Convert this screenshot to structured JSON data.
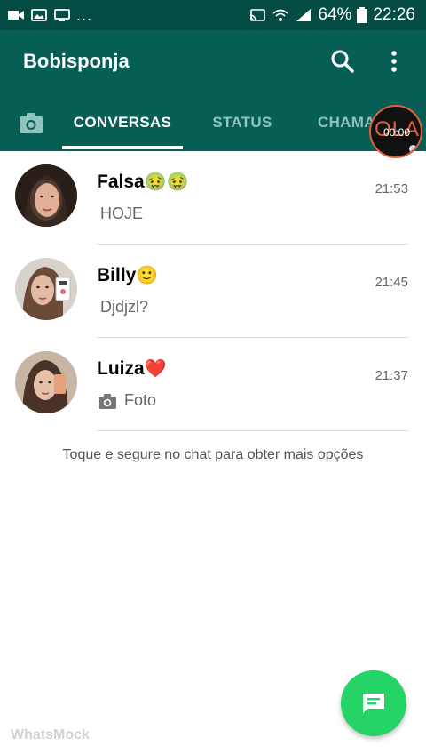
{
  "status_bar": {
    "dots": "...",
    "battery": "64%",
    "time": "22:26"
  },
  "app_bar": {
    "title": "Bobisponja",
    "tabs": [
      {
        "label": "CONVERSAS",
        "active": true
      },
      {
        "label": "STATUS",
        "active": false
      },
      {
        "label": "CHAMADAS",
        "active": false
      }
    ],
    "record_overlay": {
      "letters": "OLA",
      "time": "00:00"
    }
  },
  "chats": [
    {
      "name": "Falsa",
      "name_emoji": "🤢🤢",
      "time": "21:53",
      "message": "HOJE",
      "message_icon": ""
    },
    {
      "name": "Billy",
      "name_emoji": "🙂",
      "time": "21:45",
      "message": "Djdjzl?",
      "message_icon": ""
    },
    {
      "name": "Luiza",
      "name_emoji": "❤️",
      "time": "21:37",
      "message": "Foto",
      "message_icon": "camera-icon"
    }
  ],
  "hint": "Toque e segure no chat para obter mais opções",
  "watermark": "WhatsMock",
  "colors": {
    "status_bar": "#054d44",
    "app_bar": "#075e54",
    "inactive_tab": "#8fc3bb",
    "fab": "#25d366"
  }
}
